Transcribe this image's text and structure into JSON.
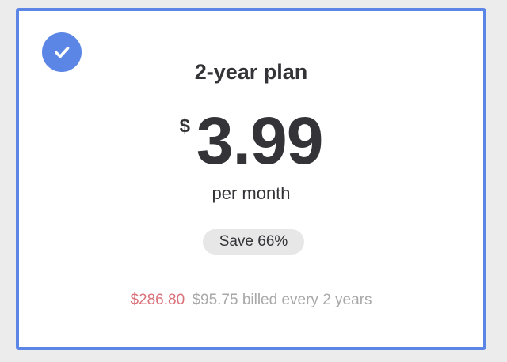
{
  "plan": {
    "selected_icon": "check-icon",
    "title": "2-year plan",
    "currency_symbol": "$",
    "price": "3.99",
    "period": "per month",
    "savings_badge": "Save 66%",
    "original_price": "$286.80",
    "billing_text": "$95.75 billed every 2 years"
  },
  "colors": {
    "accent": "#5b86e5",
    "text": "#333338",
    "strikethrough": "#d9727a",
    "muted": "#a8a8a8",
    "pill_bg": "#e7e7e7"
  }
}
